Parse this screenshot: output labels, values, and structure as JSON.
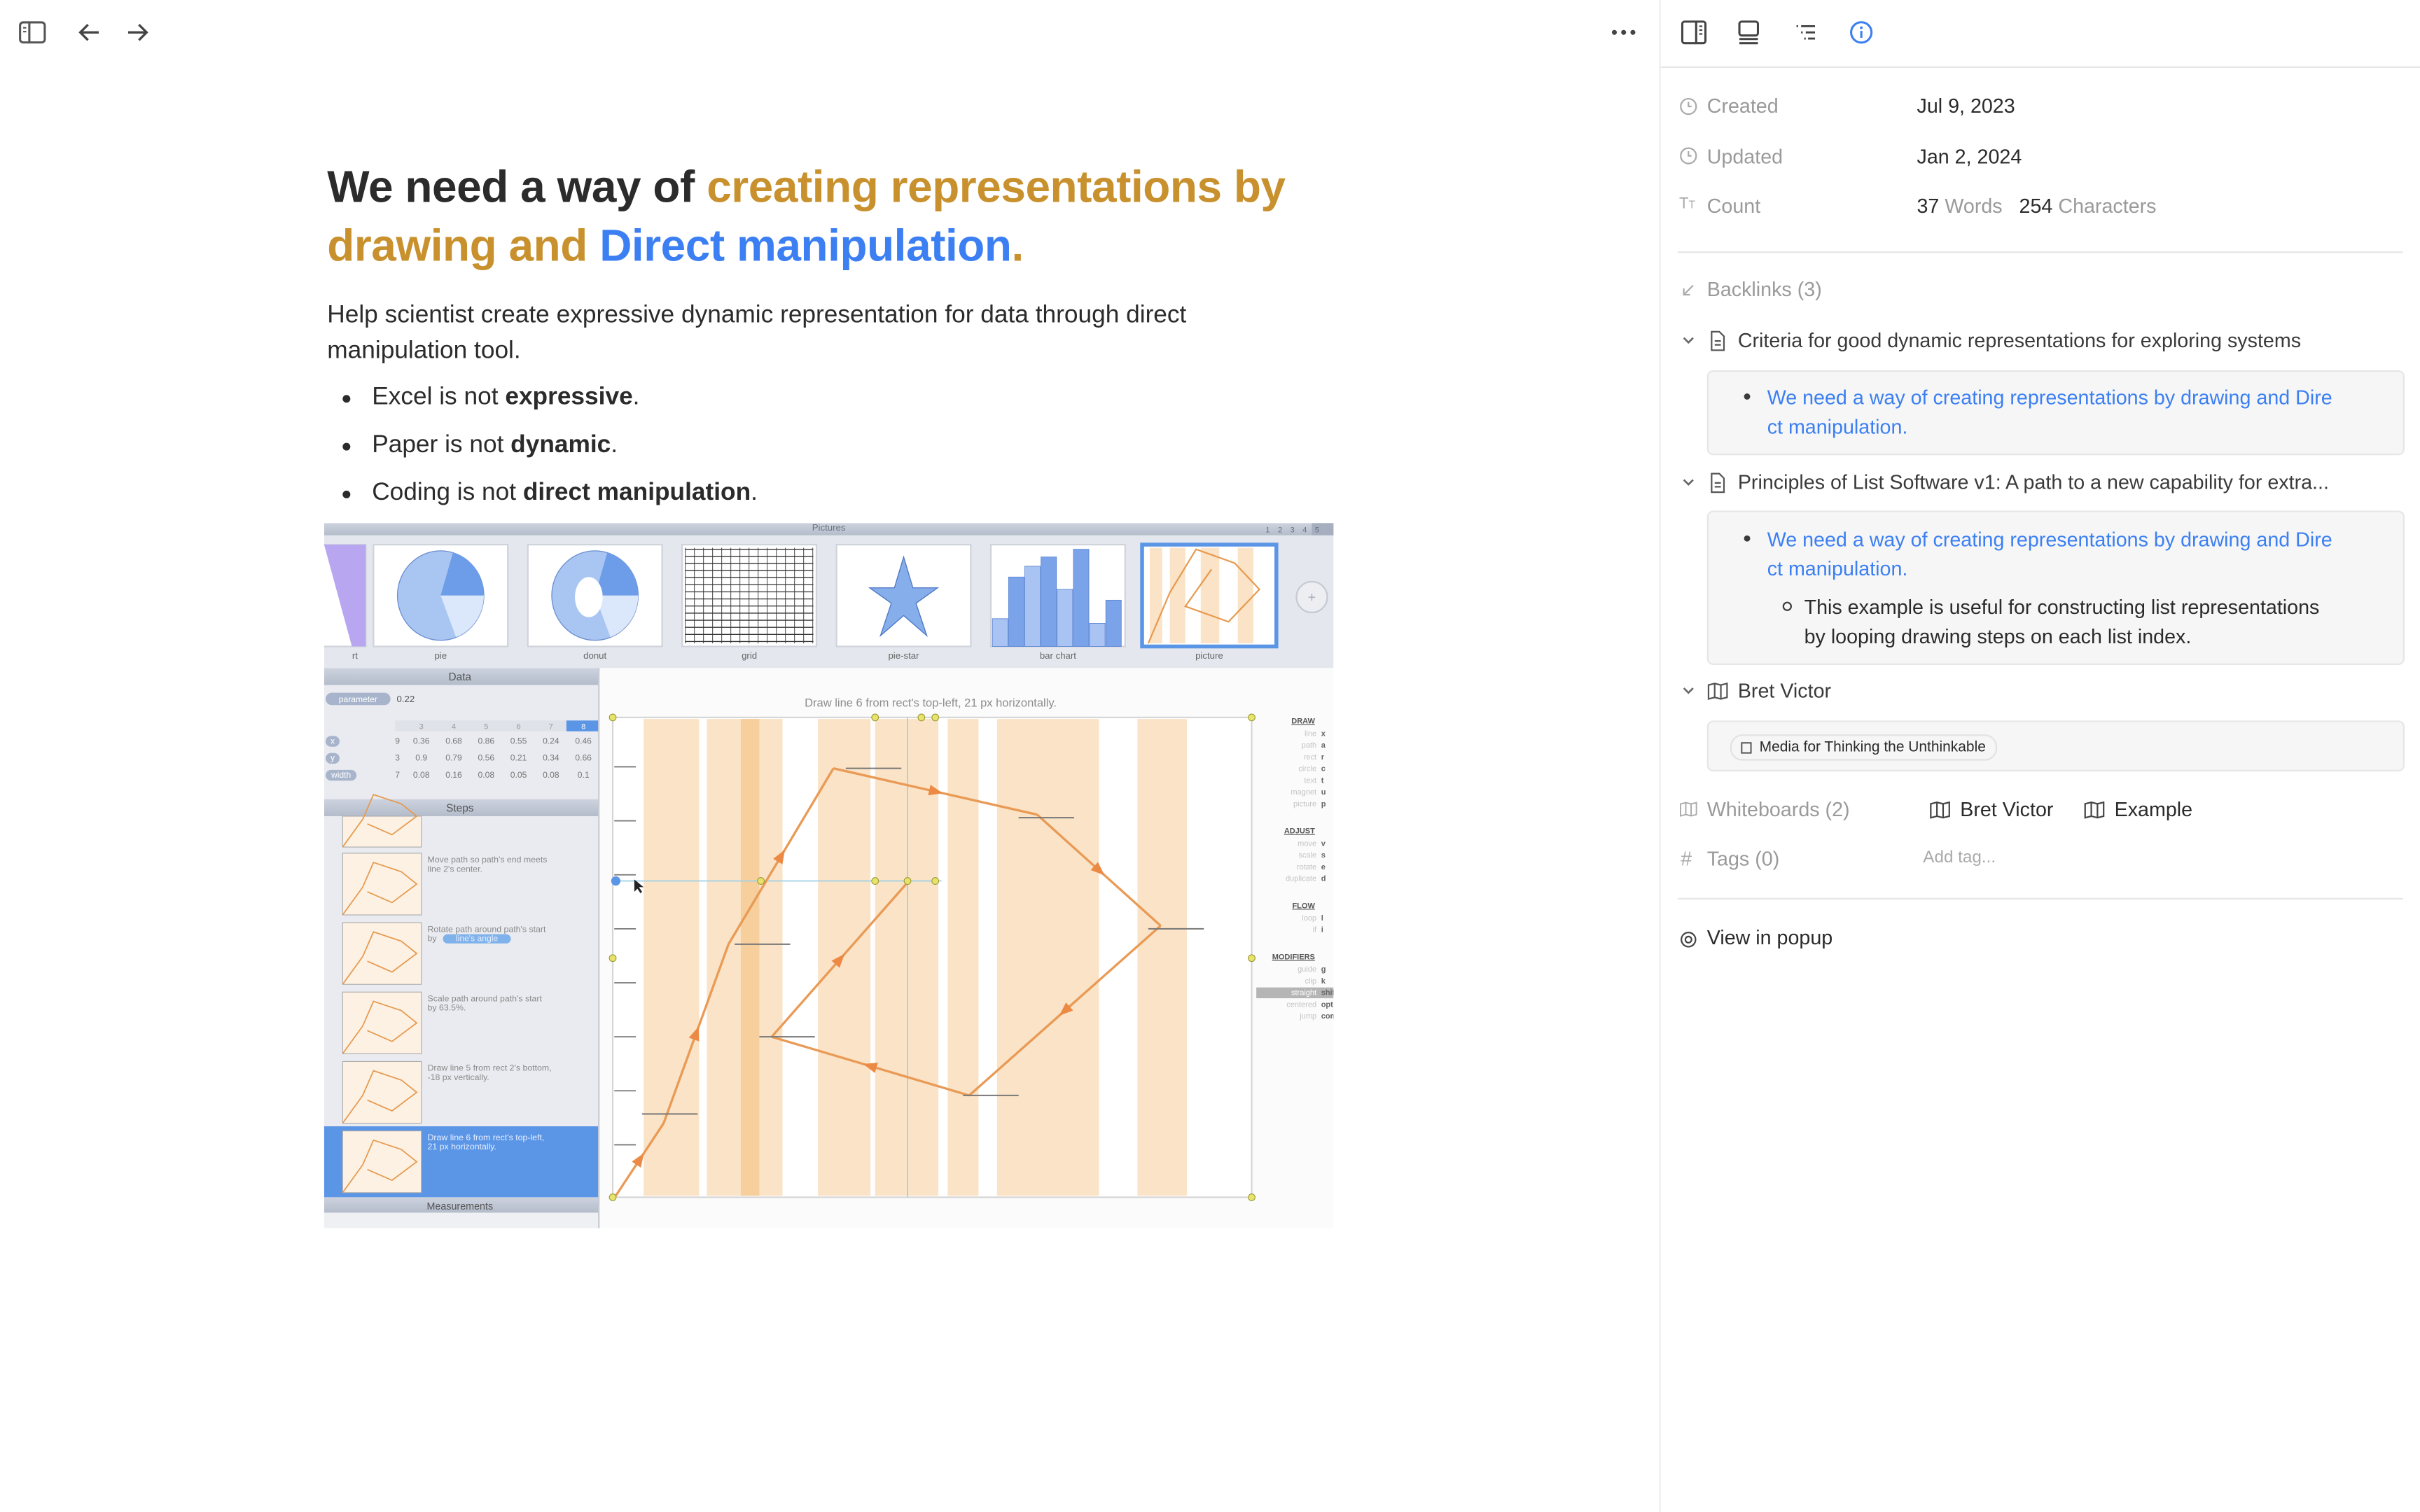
{
  "toolbar": {
    "icons": [
      "sidebar-toggle-icon",
      "arrow-left-icon",
      "arrow-right-icon",
      "more-horizontal-icon"
    ]
  },
  "document": {
    "title_plain": "We need a way of ",
    "title_orange": "creating representations by drawing and ",
    "title_blue": "Direct manipulation",
    "title_end": ".",
    "paragraph": "Help scientist create expressive dynamic representation for data through direct manipulation tool.",
    "bullets": [
      {
        "text": "Excel is not ",
        "bold": "expressive",
        "end": "."
      },
      {
        "text": "Paper is not ",
        "bold": "dynamic",
        "end": "."
      },
      {
        "text": "Coding is not ",
        "bold": "direct manipulation",
        "end": "."
      }
    ],
    "colors": {
      "orange": "#c8912e",
      "blue": "#3b7ff2"
    },
    "embedded_image": {
      "header": "Pictures",
      "pages": [
        "1",
        "2",
        "3",
        "4",
        "5"
      ],
      "thumbnails": [
        "rt",
        "pie",
        "donut",
        "grid",
        "pie-star",
        "bar chart",
        "picture"
      ],
      "data_header": "Data",
      "parameter_label": "parameter",
      "parameter_value": "0.22",
      "table_columns": [
        "3",
        "4",
        "5",
        "6",
        "7",
        "8"
      ],
      "table_rows": [
        {
          "label": "x",
          "cut": "9",
          "values": [
            "0.36",
            "0.68",
            "0.86",
            "0.55",
            "0.24",
            "0.46"
          ]
        },
        {
          "label": "y",
          "cut": "3",
          "values": [
            "0.9",
            "0.79",
            "0.56",
            "0.21",
            "0.34",
            "0.66"
          ]
        },
        {
          "label": "width",
          "cut": "7",
          "values": [
            "0.08",
            "0.16",
            "0.08",
            "0.05",
            "0.08",
            "0.1"
          ]
        }
      ],
      "steps_header": "Steps",
      "steps": [
        {
          "line1": "",
          "line2": ""
        },
        {
          "line1": "Move path so path's end meets",
          "line2": "line 2's center."
        },
        {
          "line1": "Rotate path around path's start",
          "line2": "by",
          "pill": "line's angle"
        },
        {
          "line1": "Scale path around path's start",
          "line2": "by 63.5%."
        },
        {
          "line1": "Draw line 5 from rect 2's bottom,",
          "line2": "-18 px vertically."
        },
        {
          "line1": "Draw line 6 from rect's top-left,",
          "line2": "21 px horizontally."
        }
      ],
      "measurements_header": "Measurements",
      "canvas_caption": "Draw line 6 from rect's top-left, 21 px horizontally.",
      "shortcut_groups": [
        {
          "title": "DRAW",
          "items": [
            [
              "line",
              "x"
            ],
            [
              "path",
              "a"
            ],
            [
              "rect",
              "r"
            ],
            [
              "circle",
              "c"
            ],
            [
              "text",
              "t"
            ],
            [
              "magnet",
              "u"
            ],
            [
              "picture",
              "p"
            ]
          ]
        },
        {
          "title": "ADJUST",
          "items": [
            [
              "move",
              "v"
            ],
            [
              "scale",
              "s"
            ],
            [
              "rotate",
              "e"
            ],
            [
              "duplicate",
              "d"
            ]
          ]
        },
        {
          "title": "FLOW",
          "items": [
            [
              "loop",
              "l"
            ],
            [
              "if",
              "i"
            ]
          ]
        },
        {
          "title": "MODIFIERS",
          "items": [
            [
              "guide",
              "g"
            ],
            [
              "clip",
              "k"
            ],
            [
              "straight",
              "shift"
            ],
            [
              "centered",
              "option"
            ],
            [
              "jump",
              "command"
            ]
          ]
        }
      ]
    }
  },
  "right_panel": {
    "tab_icons": [
      "split-view-icon",
      "layout-bottom-icon",
      "outline-icon",
      "info-icon"
    ],
    "created_label": "Created",
    "created_value": "Jul 9, 2023",
    "updated_label": "Updated",
    "updated_value": "Jan 2, 2024",
    "count_label": "Count",
    "words_count": "37",
    "words_label": "Words",
    "chars_count": "254",
    "chars_label": "Characters",
    "backlinks_label": "Backlinks (3)",
    "backlinks": [
      {
        "title": "Criteria for good dynamic representations for exploring systems",
        "link_line1": "We need a way of creating representations by drawing and Dire",
        "link_line2": "ct manipulation."
      },
      {
        "title": "Principles of List Software v1: A path to a new capability for extra...",
        "link_line1": "We need a way of creating representations by drawing and Dire",
        "link_line2": "ct manipulation.",
        "sub_line1": "This example is useful for constructing list representations",
        "sub_line2": "by looping drawing steps on each list index."
      },
      {
        "title": "Bret Victor",
        "chip": "Media for Thinking the Unthinkable"
      }
    ],
    "whiteboards_label": "Whiteboards (2)",
    "whiteboards": [
      "Bret Victor",
      "Example"
    ],
    "tags_label": "Tags (0)",
    "add_tag_placeholder": "Add tag...",
    "view_in_popup": "View in popup",
    "accent": "#3b7ff2"
  }
}
